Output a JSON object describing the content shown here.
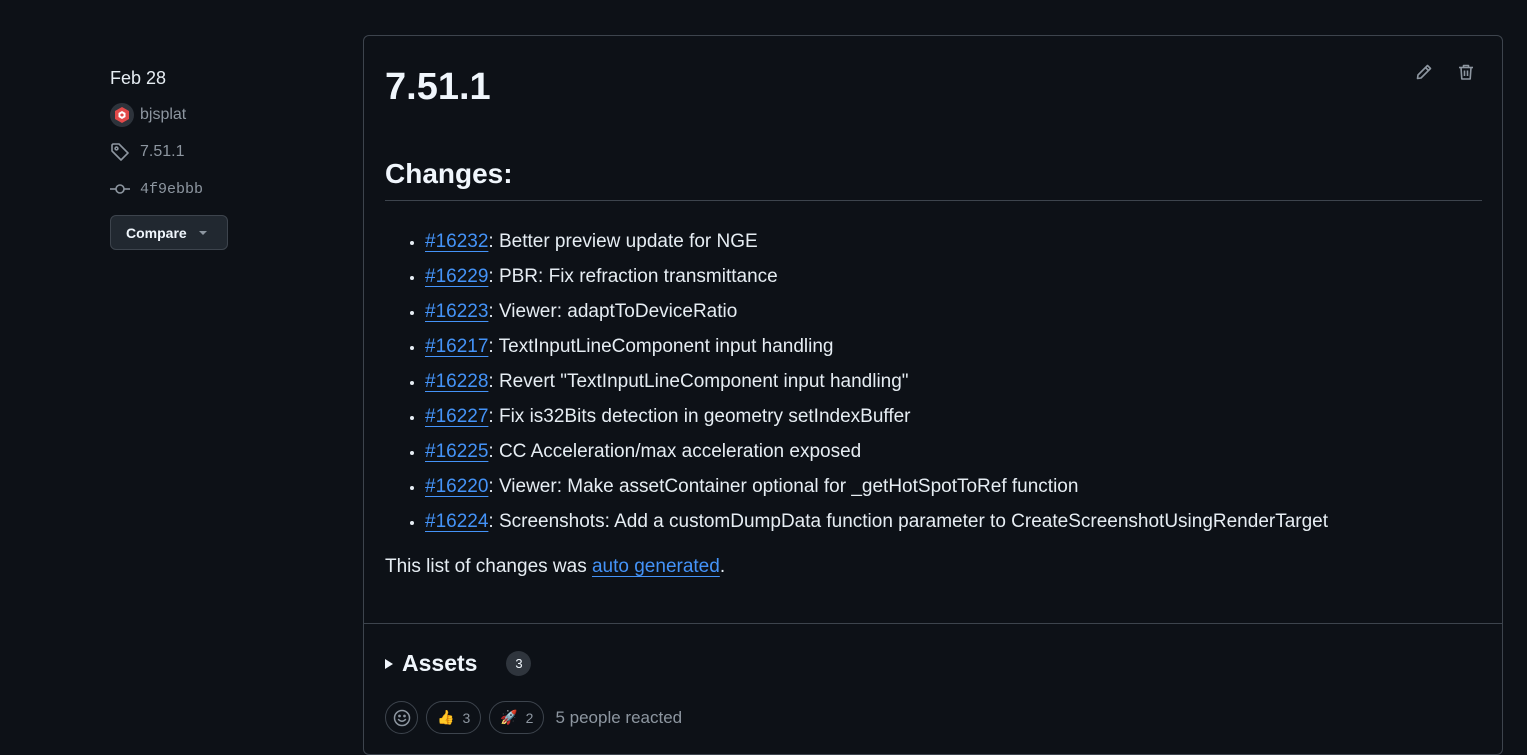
{
  "sidebar": {
    "date": "Feb 28",
    "author": "bjsplat",
    "tag": "7.51.1",
    "commit": "4f9ebbb",
    "compare_label": "Compare"
  },
  "release": {
    "title": "7.51.1",
    "changes_heading": "Changes:",
    "changes": [
      {
        "pr": "#16232",
        "text": ": Better preview update for NGE"
      },
      {
        "pr": "#16229",
        "text": ": PBR: Fix refraction transmittance"
      },
      {
        "pr": "#16223",
        "text": ": Viewer: adaptToDeviceRatio"
      },
      {
        "pr": "#16217",
        "text": ": TextInputLineComponent input handling"
      },
      {
        "pr": "#16228",
        "text": ": Revert \"TextInputLineComponent input handling\""
      },
      {
        "pr": "#16227",
        "text": ": Fix is32Bits detection in geometry setIndexBuffer"
      },
      {
        "pr": "#16225",
        "text": ": CC Acceleration/max acceleration exposed"
      },
      {
        "pr": "#16220",
        "text": ": Viewer: Make assetContainer optional for _getHotSpotToRef function"
      },
      {
        "pr": "#16224",
        "text": ": Screenshots: Add a customDumpData function parameter to CreateScreenshotUsingRenderTarget"
      }
    ],
    "footnote_prefix": "This list of changes was ",
    "footnote_link": "auto generated",
    "footnote_suffix": "."
  },
  "assets": {
    "label": "Assets",
    "count": "3"
  },
  "reactions": {
    "items": [
      {
        "emoji": "👍",
        "count": "3",
        "name": "thumbs-up"
      },
      {
        "emoji": "🚀",
        "count": "2",
        "name": "rocket"
      }
    ],
    "summary": "5 people reacted"
  },
  "icons": {
    "tag": "tag-icon",
    "commit": "commit-icon",
    "edit": "pencil-icon",
    "delete": "trash-icon",
    "smiley": "smiley-icon"
  },
  "colors": {
    "background": "#0d1117",
    "link": "#4493f8",
    "border": "#3d444d",
    "muted": "#8d96a0"
  }
}
